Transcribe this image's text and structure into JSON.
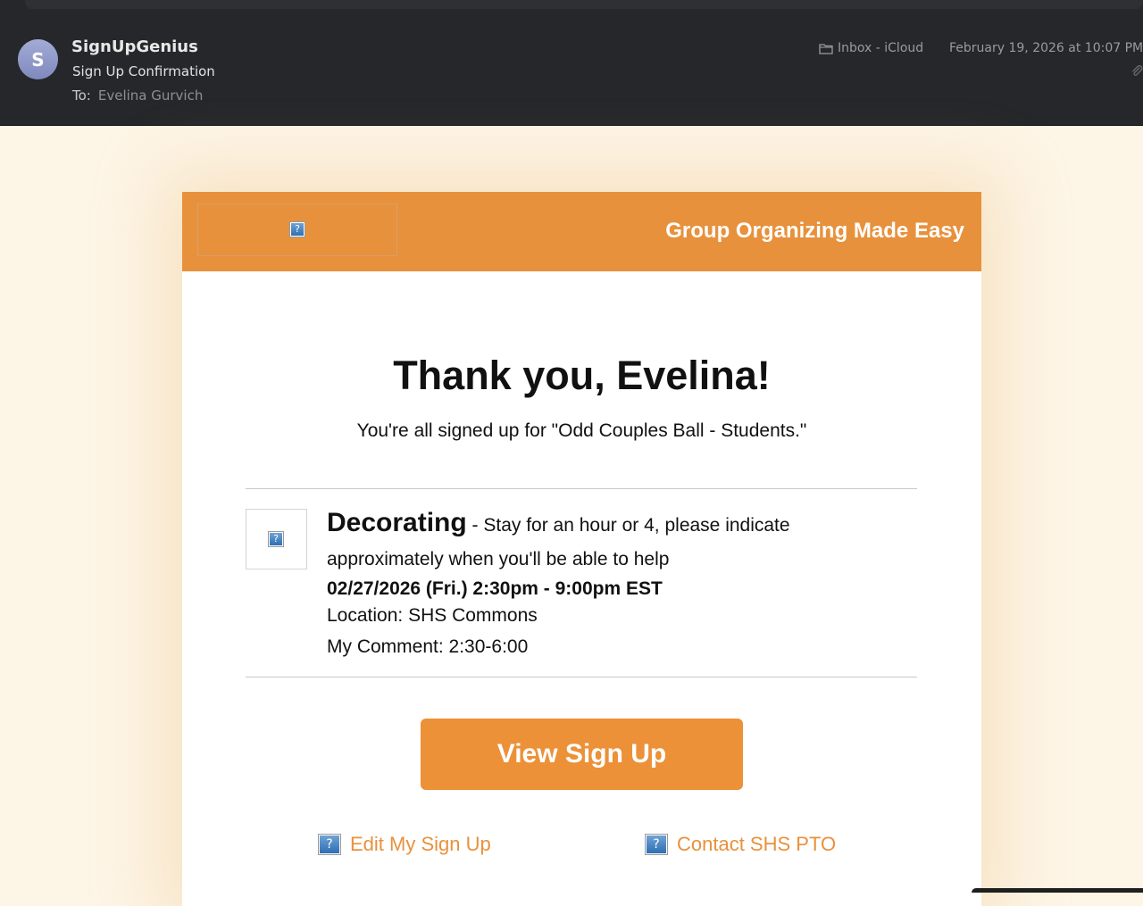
{
  "mail": {
    "avatar_initial": "S",
    "sender": "SignUpGenius",
    "subject": "Sign Up Confirmation",
    "to_label": "To:",
    "to_name": "Evelina Gurvich",
    "mailbox": "Inbox - iCloud",
    "date": "February 19, 2026 at 10:07 PM"
  },
  "email": {
    "banner_tagline": "Group Organizing Made Easy",
    "greeting": "Thank you, Evelina!",
    "confirmation": "You're all signed up for \"Odd Couples Ball - Students.\"",
    "slot": {
      "title": "Decorating",
      "desc_part1": " - Stay for an hour or 4, please indicate",
      "desc_part2": "approximately when you'll be able to help",
      "datetime": "02/27/2026 (Fri.) 2:30pm - 9:00pm EST",
      "location": "Location: SHS Commons",
      "comment": "My Comment: 2:30-6:00"
    },
    "cta_label": "View Sign Up",
    "links": {
      "edit": "Edit My Sign Up",
      "contact": "Contact SHS PTO"
    },
    "broken_image_glyph": "?"
  },
  "colors": {
    "brand_orange": "#e8913c",
    "header_bg": "#25272a",
    "page_bg": "#fdf5e6"
  }
}
